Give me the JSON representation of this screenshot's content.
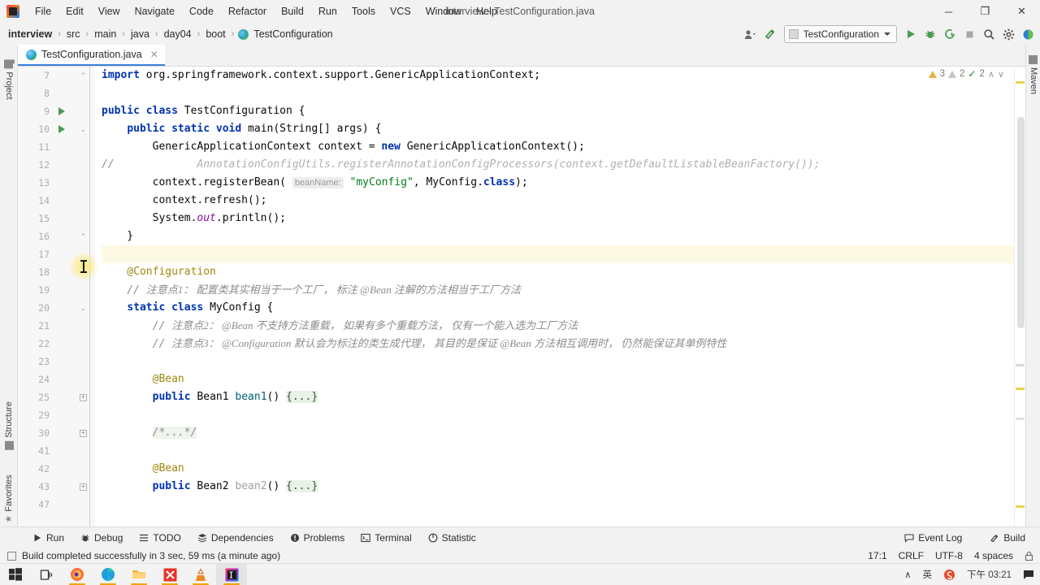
{
  "window": {
    "title": "interview - TestConfiguration.java",
    "logo_icon": "intellij-idea-logo",
    "minimize": "─",
    "maximize": "❐",
    "close": "✕"
  },
  "menubar": [
    {
      "label": "File"
    },
    {
      "label": "Edit"
    },
    {
      "label": "View"
    },
    {
      "label": "Navigate"
    },
    {
      "label": "Code"
    },
    {
      "label": "Refactor"
    },
    {
      "label": "Build"
    },
    {
      "label": "Run"
    },
    {
      "label": "Tools"
    },
    {
      "label": "VCS"
    },
    {
      "label": "Window"
    },
    {
      "label": "Help"
    }
  ],
  "breadcrumb": {
    "separator": "›",
    "items": [
      "interview",
      "src",
      "main",
      "java",
      "day04",
      "boot",
      "TestConfiguration"
    ],
    "class_icon": "java-class-icon"
  },
  "toolbar": {
    "account_icon": "user-account-icon",
    "build_hammer_icon": "build-hammer-icon",
    "run_config": "TestConfiguration",
    "run_icon": "run-play-icon",
    "debug_icon": "debug-bug-icon",
    "run_coverage_icon": "run-with-coverage-icon",
    "stop_icon": "stop-square-icon",
    "search_icon": "search-everywhere-icon",
    "settings_icon": "gear-settings-icon",
    "updates_icon": "updates-icon"
  },
  "rails": {
    "left": [
      {
        "label": "Project",
        "icon": "project-folder-icon"
      },
      {
        "label": "Structure",
        "icon": "structure-icon"
      },
      {
        "label": "Favorites",
        "icon": "favorites-star-icon"
      }
    ],
    "right": [
      {
        "label": "Maven",
        "icon": "maven-icon"
      }
    ]
  },
  "editor_tab": {
    "label": "TestConfiguration.java",
    "icon": "java-class-icon",
    "close": "✕"
  },
  "inspections": {
    "warnings": "3",
    "weak_warnings": "2",
    "checks": "2",
    "up": "∧",
    "down": "∨"
  },
  "code_lines": [
    {
      "num": "7",
      "run": false,
      "fold": "arrow-collapsed",
      "current": false,
      "tokens": [
        {
          "t": "import ",
          "c": "kw"
        },
        {
          "t": "org.springframework.context.support.GenericApplicationContext;",
          "c": "pln"
        }
      ]
    },
    {
      "num": "8",
      "run": false,
      "fold": null,
      "current": false,
      "tokens": []
    },
    {
      "num": "9",
      "run": true,
      "fold": null,
      "current": false,
      "tokens": [
        {
          "t": "public ",
          "c": "kw"
        },
        {
          "t": "class ",
          "c": "kw"
        },
        {
          "t": "TestConfiguration ",
          "c": "pln"
        },
        {
          "t": "{",
          "c": "pln"
        }
      ]
    },
    {
      "num": "10",
      "run": true,
      "fold": "arrow-open",
      "current": false,
      "tokens": [
        {
          "t": "    ",
          "c": "pln"
        },
        {
          "t": "public ",
          "c": "kw"
        },
        {
          "t": "static ",
          "c": "kw"
        },
        {
          "t": "void ",
          "c": "kw"
        },
        {
          "t": "main",
          "c": "pln"
        },
        {
          "t": "(String[] args) {",
          "c": "pln"
        }
      ]
    },
    {
      "num": "11",
      "run": false,
      "fold": null,
      "current": false,
      "tokens": [
        {
          "t": "        GenericApplicationContext context = ",
          "c": "pln"
        },
        {
          "t": "new ",
          "c": "kw"
        },
        {
          "t": "GenericApplicationContext();",
          "c": "pln"
        }
      ]
    },
    {
      "num": "12",
      "run": false,
      "fold": null,
      "current": false,
      "commented": "//",
      "tokens": [
        {
          "t": "            AnnotationConfigUtils.registerAnnotationConfigProcessors(context.getDefaultListableBeanFactory());",
          "c": "cmt2"
        }
      ]
    },
    {
      "num": "13",
      "run": false,
      "fold": null,
      "current": false,
      "tokens": [
        {
          "t": "        context.registerBean( ",
          "c": "pln"
        },
        {
          "t": "beanName:",
          "c": "hintbg"
        },
        {
          "t": " ",
          "c": "pln"
        },
        {
          "t": "\"myConfig\"",
          "c": "str"
        },
        {
          "t": ", MyConfig.",
          "c": "pln"
        },
        {
          "t": "class",
          "c": "kw"
        },
        {
          "t": ");",
          "c": "pln"
        }
      ]
    },
    {
      "num": "14",
      "run": false,
      "fold": null,
      "current": false,
      "tokens": [
        {
          "t": "        context.refresh();",
          "c": "pln"
        }
      ]
    },
    {
      "num": "15",
      "run": false,
      "fold": null,
      "current": false,
      "tokens": [
        {
          "t": "        System.",
          "c": "pln"
        },
        {
          "t": "out",
          "c": "fld"
        },
        {
          "t": ".println();",
          "c": "pln"
        }
      ]
    },
    {
      "num": "16",
      "run": false,
      "fold": "arrow-close",
      "current": false,
      "tokens": [
        {
          "t": "    }",
          "c": "pln"
        }
      ]
    },
    {
      "num": "17",
      "run": false,
      "fold": null,
      "current": true,
      "tokens": []
    },
    {
      "num": "18",
      "run": false,
      "fold": null,
      "current": false,
      "tokens": [
        {
          "t": "    @Configuration",
          "c": "ann"
        }
      ]
    },
    {
      "num": "19",
      "run": false,
      "fold": null,
      "current": false,
      "tokens": [
        {
          "t": "    // ",
          "c": "cmt"
        },
        {
          "t": "注意点1： 配置类其实相当于一个工厂， 标注 @Bean 注解的方法相当于工厂方法",
          "c": "cmtcn"
        }
      ]
    },
    {
      "num": "20",
      "run": false,
      "fold": "arrow-open",
      "current": false,
      "tokens": [
        {
          "t": "    ",
          "c": "pln"
        },
        {
          "t": "static ",
          "c": "kw"
        },
        {
          "t": "class ",
          "c": "kw"
        },
        {
          "t": "MyConfig ",
          "c": "pln"
        },
        {
          "t": "{",
          "c": "pln"
        }
      ]
    },
    {
      "num": "21",
      "run": false,
      "fold": null,
      "current": false,
      "tokens": [
        {
          "t": "        // ",
          "c": "cmt"
        },
        {
          "t": "注意点2： @Bean 不支持方法重载， 如果有多个重载方法， 仅有一个能入选为工厂方法",
          "c": "cmtcn"
        }
      ]
    },
    {
      "num": "22",
      "run": false,
      "fold": null,
      "current": false,
      "tokens": [
        {
          "t": "        // ",
          "c": "cmt"
        },
        {
          "t": "注意点3： @Configuration 默认会为标注的类生成代理， 其目的是保证 @Bean 方法相互调用时， 仍然能保证其单例特性",
          "c": "cmtcn"
        }
      ]
    },
    {
      "num": "23",
      "run": false,
      "fold": null,
      "current": false,
      "tokens": []
    },
    {
      "num": "24",
      "run": false,
      "fold": null,
      "current": false,
      "tokens": [
        {
          "t": "        @Bean",
          "c": "ann"
        }
      ]
    },
    {
      "num": "25",
      "run": false,
      "fold": "plus",
      "current": false,
      "tokens": [
        {
          "t": "        ",
          "c": "pln"
        },
        {
          "t": "public ",
          "c": "kw"
        },
        {
          "t": "Bean1 ",
          "c": "pln"
        },
        {
          "t": "bean1",
          "c": "mth"
        },
        {
          "t": "() ",
          "c": "pln"
        },
        {
          "t": "{...}",
          "c": "foldbox"
        }
      ]
    },
    {
      "num": "29",
      "run": false,
      "fold": null,
      "current": false,
      "tokens": []
    },
    {
      "num": "30",
      "run": false,
      "fold": "plus",
      "current": false,
      "tokens": [
        {
          "t": "        ",
          "c": "pln"
        },
        {
          "t": "/*...*/",
          "c": "foldbox2"
        }
      ]
    },
    {
      "num": "41",
      "run": false,
      "fold": null,
      "current": false,
      "tokens": []
    },
    {
      "num": "42",
      "run": false,
      "fold": null,
      "current": false,
      "tokens": [
        {
          "t": "        @Bean",
          "c": "ann"
        }
      ]
    },
    {
      "num": "43",
      "run": false,
      "fold": "plus",
      "current": false,
      "tokens": [
        {
          "t": "        ",
          "c": "pln"
        },
        {
          "t": "public ",
          "c": "kw"
        },
        {
          "t": "Bean2 ",
          "c": "pln"
        },
        {
          "t": "bean2",
          "c": "mthg"
        },
        {
          "t": "() ",
          "c": "pln"
        },
        {
          "t": "{...}",
          "c": "foldbox"
        }
      ]
    },
    {
      "num": "47",
      "run": false,
      "fold": null,
      "current": false,
      "tokens": []
    }
  ],
  "bottom_tools": [
    {
      "label": "Run",
      "icon": "run-play-icon"
    },
    {
      "label": "Debug",
      "icon": "debug-bug-icon"
    },
    {
      "label": "TODO",
      "icon": "todo-list-icon"
    },
    {
      "label": "Dependencies",
      "icon": "dependencies-icon"
    },
    {
      "label": "Problems",
      "icon": "problems-icon"
    },
    {
      "label": "Terminal",
      "icon": "terminal-icon"
    },
    {
      "label": "Statistic",
      "icon": "statistic-icon"
    }
  ],
  "bottom_tools_right": [
    {
      "label": "Event Log",
      "icon": "event-log-icon"
    },
    {
      "label": "Build",
      "icon": "build-hammer-icon"
    }
  ],
  "statusbar": {
    "message": "Build completed successfully in 3 sec, 59 ms (a minute ago)",
    "message_icon": "build-status-icon",
    "caret_position": "17:1",
    "line_separator": "CRLF",
    "encoding": "UTF-8",
    "indent": "4 spaces",
    "lock_icon": "read-only-lock-icon"
  },
  "taskbar": {
    "apps": [
      {
        "name": "start-windows-icon",
        "running": false,
        "active": false
      },
      {
        "name": "task-view-icon",
        "running": false,
        "active": false
      },
      {
        "name": "firefox-icon",
        "running": true,
        "active": false
      },
      {
        "name": "edge-icon",
        "running": true,
        "active": false
      },
      {
        "name": "file-explorer-icon",
        "running": true,
        "active": false
      },
      {
        "name": "xmind-icon",
        "running": true,
        "active": false
      },
      {
        "name": "vlc-icon",
        "running": true,
        "active": false
      },
      {
        "name": "intellij-idea-icon",
        "running": true,
        "active": true
      }
    ],
    "tray": [
      {
        "name": "show-hidden-icons",
        "label": "∧"
      },
      {
        "name": "ime-indicator",
        "label": "英"
      },
      {
        "name": "sogou-input-icon",
        "label": "S"
      },
      {
        "name": "clock",
        "label": "下午 03:21"
      },
      {
        "name": "notifications-icon",
        "label": "■"
      }
    ]
  },
  "colors": {
    "accent": "#3c7fdc",
    "run_green": "#499c54",
    "warning": "#e3b341",
    "string_green": "#067d17",
    "keyword_blue": "#0033b3",
    "annotation": "#9e880d",
    "current_line": "#fcfae4"
  }
}
